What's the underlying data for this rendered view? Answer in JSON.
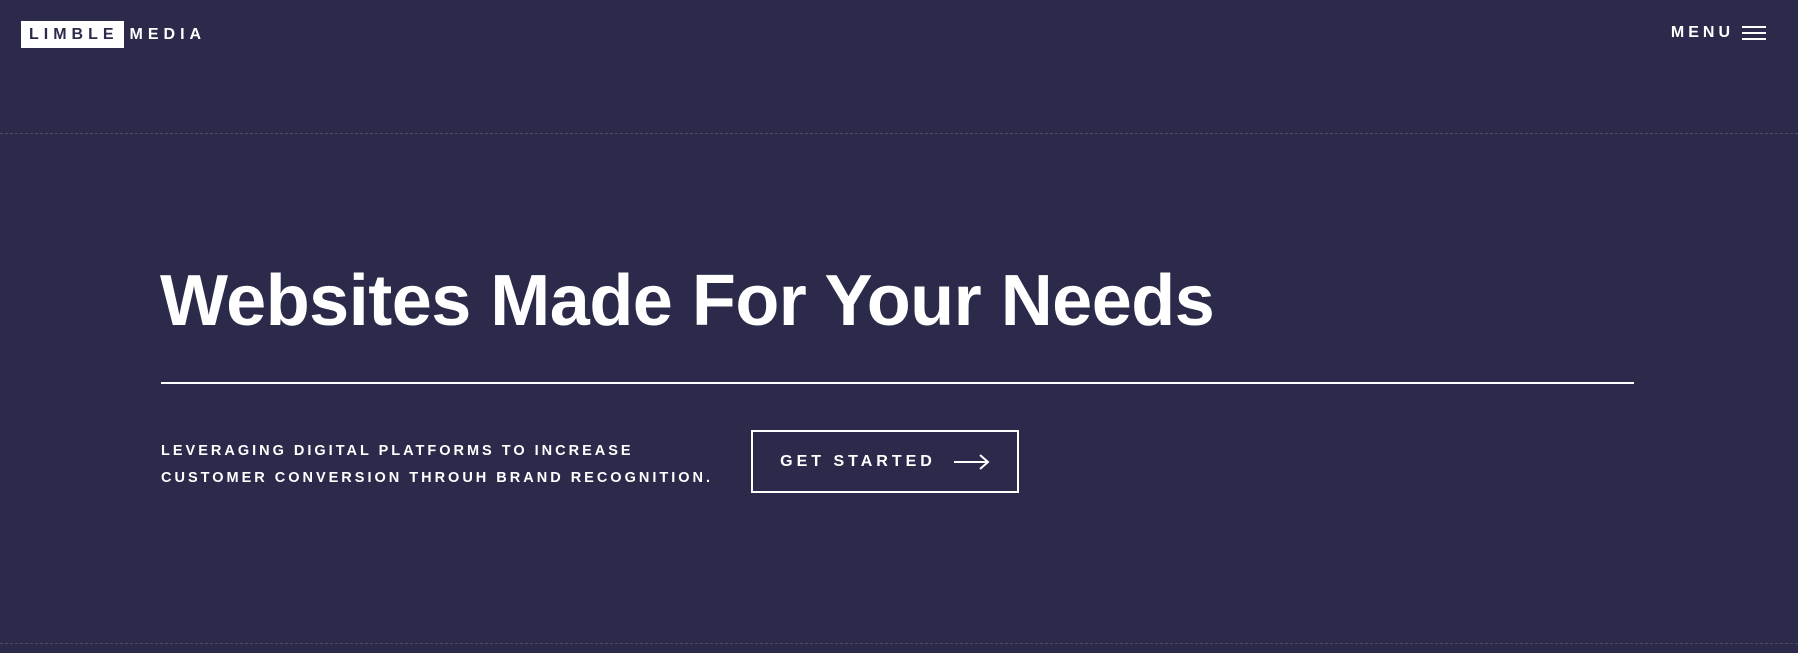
{
  "brand": {
    "logo_box_text": "LIMBLE",
    "logo_text": "MEDIA"
  },
  "nav": {
    "menu_label": "MENU",
    "menu_icon": "hamburger-icon"
  },
  "hero": {
    "title": "Websites Made For Your Needs",
    "tagline_line1": "LEVERAGING DIGITAL PLATFORMS TO INCREASE",
    "tagline_line2": "CUSTOMER CONVERSION THROUH BRAND RECOGNITION.",
    "cta_label": "GET STARTED",
    "cta_icon": "arrow-right-icon"
  },
  "colors": {
    "background": "#2b2a4a",
    "text": "#ffffff"
  }
}
